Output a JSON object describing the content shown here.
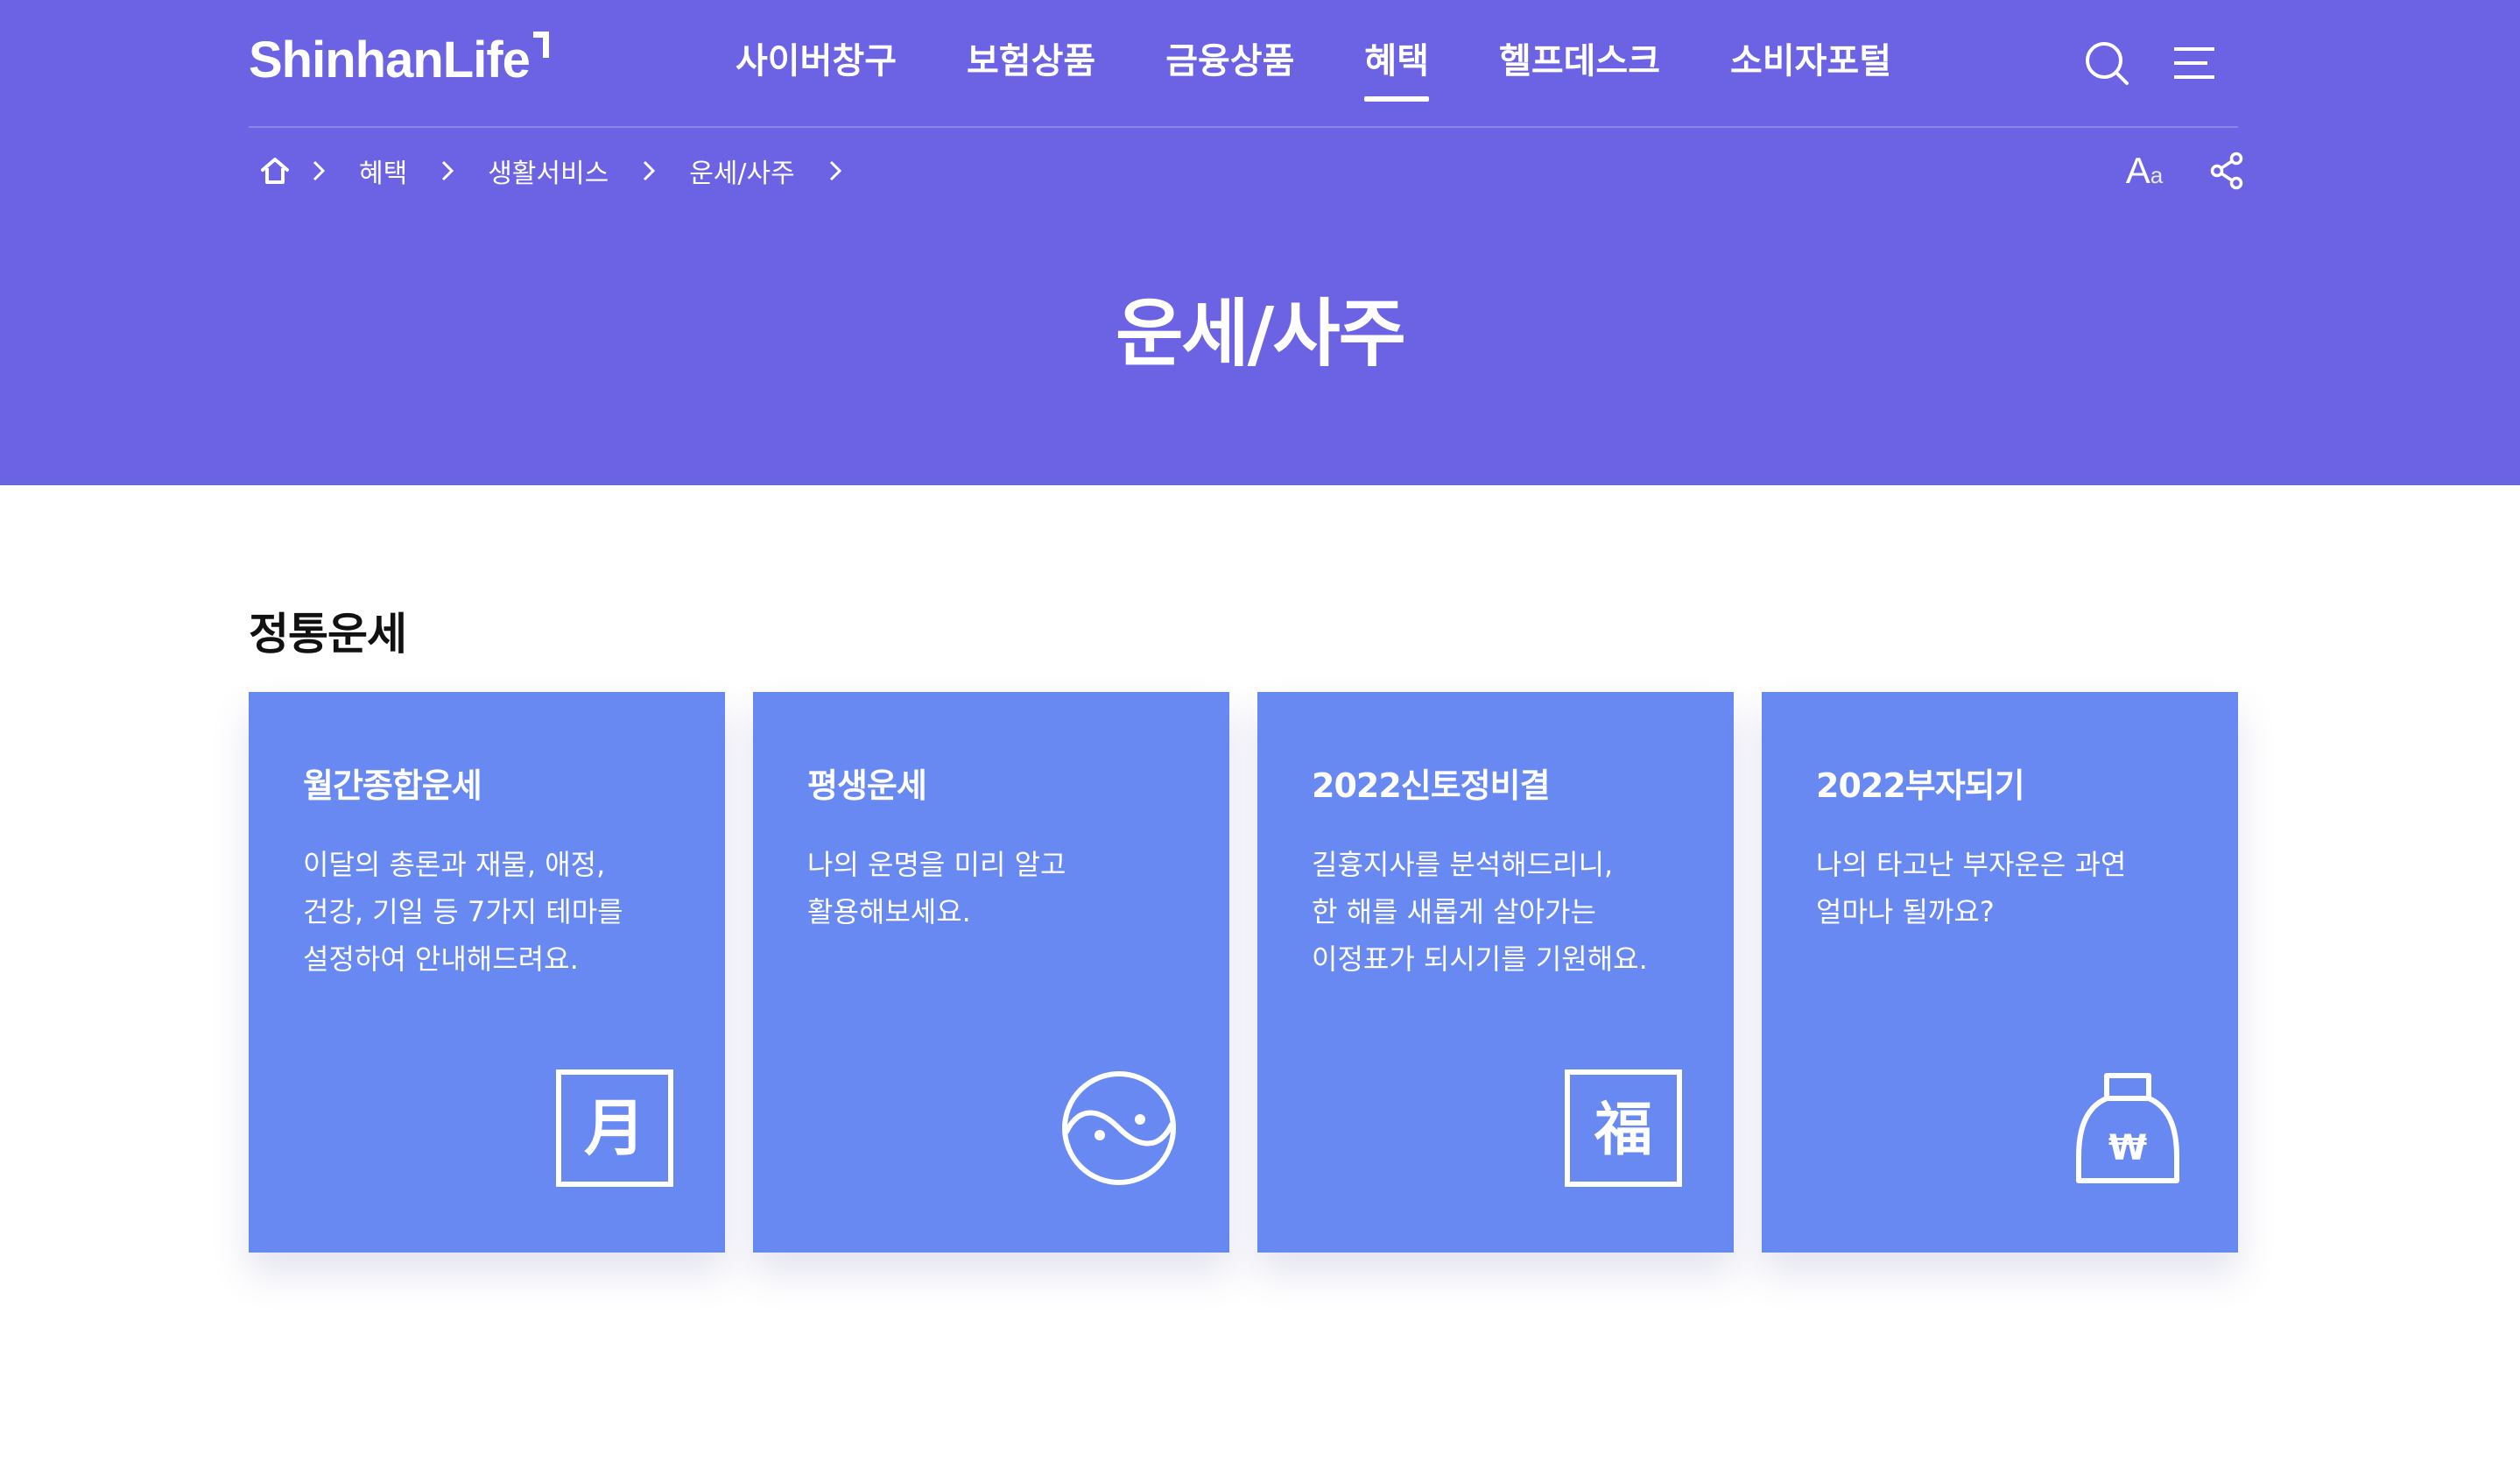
{
  "header": {
    "logo_text": "ShinhanLife",
    "nav": [
      "사이버창구",
      "보험상품",
      "금융상품",
      "혜택",
      "헬프데스크",
      "소비자포털"
    ],
    "active_nav_index": 3,
    "icons": [
      "search-icon",
      "hamburger-menu-icon"
    ]
  },
  "breadcrumb": {
    "items": [
      "혜택",
      "생활서비스",
      "운세/사주"
    ],
    "icons": [
      "home-icon",
      "chevron-right-icon"
    ],
    "tools": {
      "font_size_big": "A",
      "font_size_small": "a",
      "icons": [
        "font-size-icon",
        "share-icon"
      ]
    }
  },
  "page": {
    "title": "운세/사주"
  },
  "section": {
    "title": "정통운세"
  },
  "cards": [
    {
      "title": "월간종합운세",
      "desc": [
        "이달의 총론과 재물, 애정,",
        "건강, 기일 등 7가지 테마를",
        "설정하여 안내해드려요."
      ],
      "icon": "moon-character-icon",
      "icon_text": "月"
    },
    {
      "title": "평생운세",
      "desc": [
        "나의 운명을 미리 알고",
        "활용해보세요."
      ],
      "icon": "yin-yang-icon"
    },
    {
      "title": "2022신토정비결",
      "desc": [
        "길흉지사를 분석해드리니,",
        "한 해를 새롭게 살아가는",
        "이정표가 되시기를 기원해요."
      ],
      "icon": "fortune-character-icon",
      "icon_text": "福"
    },
    {
      "title": "2022부자되기",
      "desc": [
        "나의 타고난 부자운은 과연",
        "얼마나 될까요?"
      ],
      "icon": "money-bag-icon",
      "icon_text": "₩"
    }
  ],
  "colors": {
    "hero_bg": "#6c62e4",
    "card_bg": "#6889f2",
    "text_dark": "#111111",
    "white": "#ffffff"
  }
}
